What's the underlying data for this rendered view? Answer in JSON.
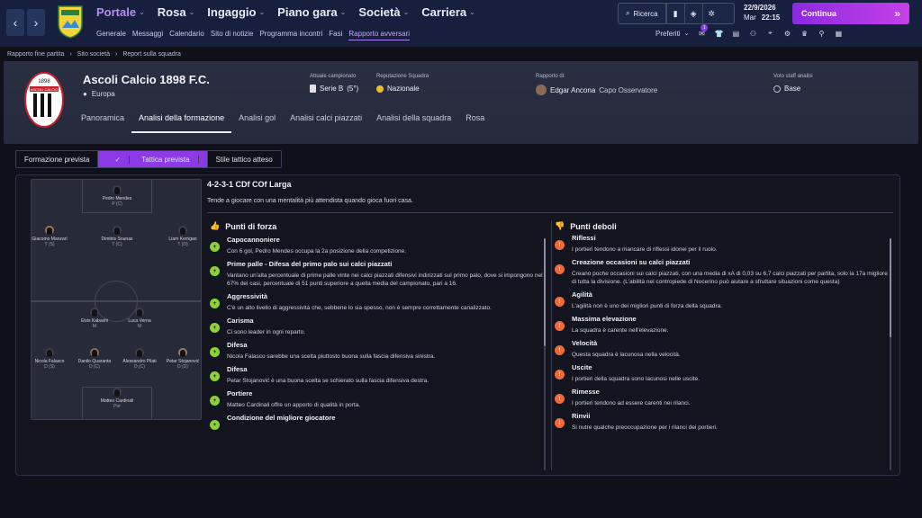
{
  "topbar": {
    "menu": [
      {
        "label": "Portale",
        "active": true
      },
      {
        "label": "Rosa"
      },
      {
        "label": "Ingaggio"
      },
      {
        "label": "Piano gara"
      },
      {
        "label": "Società"
      },
      {
        "label": "Carriera"
      }
    ],
    "submenu": [
      "Generale",
      "Messaggi",
      "Calendario",
      "Sito di notizie",
      "Programma incontri",
      "Fasi",
      "Rapporto avversari"
    ],
    "submenu_active": "Rapporto avversari",
    "search_label": "Ricerca",
    "date": "22/9/2026",
    "day_time_day": "Mar",
    "day_time_time": "22:15",
    "continue_label": "Continua",
    "favorites_label": "Preferiti",
    "notification_count": "1",
    "accent": "#b07ff0"
  },
  "breadcrumbs": [
    "Rapporto fine partita",
    "Sito società",
    "Report sulla squadra"
  ],
  "team": {
    "name": "Ascoli Calcio 1898 F.C.",
    "region": "Europa",
    "crest_year": "1898",
    "crest_text": "ASCOLI CALCIO",
    "current_league_label": "Attuale campionato",
    "current_league": "Serie B",
    "current_league_pos": "(5°)",
    "reputation_label": "Reputazione Squadra",
    "reputation": "Nazionale",
    "report_by_label": "Rapporto di:",
    "report_by": "Edgar Ancona",
    "report_role": "Capo Osservatore",
    "staff_vote_label": "Voto staff analisi",
    "staff_vote": "Base"
  },
  "tabs": [
    "Panoramica",
    "Analisi della formazione",
    "Analisi gol",
    "Analisi calci piazzati",
    "Analisi della squadra",
    "Rosa"
  ],
  "subtabs": [
    "Formazione prevista",
    "Tattica prevista",
    "Stile tattico atteso"
  ],
  "formation": {
    "title": "4-2-3-1 CDf COf Larga",
    "description": "Tende a giocare con una mentalità più attendista quando gioca fuori casa."
  },
  "players": [
    {
      "name": "Pedro Mendes",
      "pos": "P (C)"
    },
    {
      "name": "Giacomo Manzari",
      "pos": "T (S)"
    },
    {
      "name": "Dimitris Sounas",
      "pos": "T (C)"
    },
    {
      "name": "Liam Kerrigan",
      "pos": "T (D)"
    },
    {
      "name": "Elvis Kabashi",
      "pos": "M"
    },
    {
      "name": "Luca Verna",
      "pos": "M"
    },
    {
      "name": "Nicola Falasco",
      "pos": "D (S)"
    },
    {
      "name": "Danilo Quaranta",
      "pos": "D (C)"
    },
    {
      "name": "Alessandro Pilati",
      "pos": "D (C)"
    },
    {
      "name": "Petar Stojanović",
      "pos": "D (D)"
    },
    {
      "name": "Matteo Cardinali",
      "pos": "Por"
    }
  ],
  "strengths": {
    "heading": "Punti di forza",
    "items": [
      {
        "title": "Capocannoniere",
        "text": "Con 6 gol, Pedro Mendes occupa la 2a posizione della competizione."
      },
      {
        "title": "Prime palle - Difesa del primo palo sui calci piazzati",
        "text": "Vantano un'alta percentuale di prime palle vinte nei calci piazzati difensivi indirizzati sul primo palo, dove si impongono nel 67% dei casi, percentuale di 51 punti superiore a quella media del campionato, pari a 16."
      },
      {
        "title": "Aggressività",
        "text": "C'è un alto livello di aggressività che, sebbene lo sia spesso, non è sempre correttamente canalizzato."
      },
      {
        "title": "Carisma",
        "text": "Ci sono leader in ogni reparto."
      },
      {
        "title": "Difesa",
        "text": "Nicola Falasco sarebbe una scelta piuttosto buona sulla fascia difensiva sinistra."
      },
      {
        "title": "Difesa",
        "text": "Petar Stojanović è una buona scelta se schierato sulla fascia difensiva destra."
      },
      {
        "title": "Portiere",
        "text": "Matteo Cardinali offre un apporto di qualità in porta."
      },
      {
        "title": "Condizione del migliore giocatore",
        "text": ""
      }
    ]
  },
  "weaknesses": {
    "heading": "Punti deboli",
    "items": [
      {
        "title": "Riflessi",
        "text": "I portieri tendono a mancare di riflessi idonei per il ruolo."
      },
      {
        "title": "Creazione occasioni su calci piazzati",
        "text": "Creano poche occasioni sui calci piazzati, con una media di xA di 0,03 su 6,7 calci piazzati per partita, solo la 17a migliore di tutta la divisione. (L'abilità nel contropiede di Nocerino può aiutare a sfruttare situazioni come questa)"
      },
      {
        "title": "Agilità",
        "text": "L'agilità non è uno dei migliori punti di forza della squadra."
      },
      {
        "title": "Massima elevazione",
        "text": "La squadra è carente nell'elevazione."
      },
      {
        "title": "Velocità",
        "text": "Questa squadra è lacunosa nella velocità."
      },
      {
        "title": "Uscite",
        "text": "I portieri della squadra sono lacunosi nelle uscite."
      },
      {
        "title": "Rimesse",
        "text": "I portieri tendono ad essere carenti nei rilanci."
      },
      {
        "title": "Rinvii",
        "text": "Si nutre qualche preoccupazione per i rilanci dei portieri."
      }
    ]
  },
  "colors": {
    "good": "#8ad332",
    "bad": "#ee6a3a",
    "accent": "#8c3ae6"
  }
}
